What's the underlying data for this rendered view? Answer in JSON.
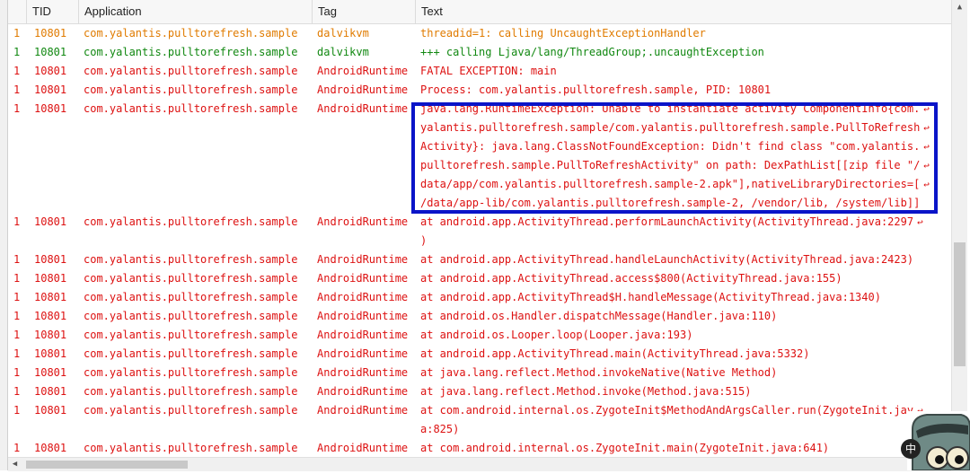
{
  "columns": {
    "tid": "TID",
    "application": "Application",
    "tag": "Tag",
    "text": "Text"
  },
  "colors": {
    "error": "#dd1111",
    "warn": "#e07b00",
    "info": "#118811",
    "highlight": "#0a14c8"
  },
  "rows": [
    {
      "level": "1",
      "tid": "10801",
      "app": "com.yalantis.pulltorefresh.sample",
      "tag": "dalvikvm",
      "text_lines": [
        "threadid=1: calling UncaughtExceptionHandler"
      ],
      "style": "orange"
    },
    {
      "level": "1",
      "tid": "10801",
      "app": "com.yalantis.pulltorefresh.sample",
      "tag": "dalvikvm",
      "text_lines": [
        "+++ calling Ljava/lang/ThreadGroup;.uncaughtException"
      ],
      "style": "green"
    },
    {
      "level": "1",
      "tid": "10801",
      "app": "com.yalantis.pulltorefresh.sample",
      "tag": "AndroidRuntime",
      "text_lines": [
        "FATAL EXCEPTION: main"
      ],
      "style": "red"
    },
    {
      "level": "1",
      "tid": "10801",
      "app": "com.yalantis.pulltorefresh.sample",
      "tag": "AndroidRuntime",
      "text_lines": [
        "Process: com.yalantis.pulltorefresh.sample, PID: 10801"
      ],
      "style": "red"
    },
    {
      "level": "1",
      "tid": "10801",
      "app": "com.yalantis.pulltorefresh.sample",
      "tag": "AndroidRuntime",
      "text_lines": [
        "java.lang.RuntimeException: Unable to instantiate activity ComponentInfo{com.",
        "yalantis.pulltorefresh.sample/com.yalantis.pulltorefresh.sample.PullToRefresh",
        "Activity}: java.lang.ClassNotFoundException: Didn't find class \"com.yalantis.",
        "pulltorefresh.sample.PullToRefreshActivity\" on path: DexPathList[[zip file \"/",
        "data/app/com.yalantis.pulltorefresh.sample-2.apk\"],nativeLibraryDirectories=[",
        "/data/app-lib/com.yalantis.pulltorefresh.sample-2, /vendor/lib, /system/lib]]"
      ],
      "wrap_marks": 5,
      "style": "red",
      "highlight": true
    },
    {
      "level": "1",
      "tid": "10801",
      "app": "com.yalantis.pulltorefresh.sample",
      "tag": "AndroidRuntime",
      "text_lines": [
        "at android.app.ActivityThread.performLaunchActivity(ActivityThread.java:2297",
        ")"
      ],
      "wrap_marks": 1,
      "style": "red"
    },
    {
      "level": "1",
      "tid": "10801",
      "app": "com.yalantis.pulltorefresh.sample",
      "tag": "AndroidRuntime",
      "text_lines": [
        "at android.app.ActivityThread.handleLaunchActivity(ActivityThread.java:2423)"
      ],
      "style": "red"
    },
    {
      "level": "1",
      "tid": "10801",
      "app": "com.yalantis.pulltorefresh.sample",
      "tag": "AndroidRuntime",
      "text_lines": [
        "at android.app.ActivityThread.access$800(ActivityThread.java:155)"
      ],
      "style": "red"
    },
    {
      "level": "1",
      "tid": "10801",
      "app": "com.yalantis.pulltorefresh.sample",
      "tag": "AndroidRuntime",
      "text_lines": [
        "at android.app.ActivityThread$H.handleMessage(ActivityThread.java:1340)"
      ],
      "style": "red"
    },
    {
      "level": "1",
      "tid": "10801",
      "app": "com.yalantis.pulltorefresh.sample",
      "tag": "AndroidRuntime",
      "text_lines": [
        "at android.os.Handler.dispatchMessage(Handler.java:110)"
      ],
      "style": "red"
    },
    {
      "level": "1",
      "tid": "10801",
      "app": "com.yalantis.pulltorefresh.sample",
      "tag": "AndroidRuntime",
      "text_lines": [
        "at android.os.Looper.loop(Looper.java:193)"
      ],
      "style": "red"
    },
    {
      "level": "1",
      "tid": "10801",
      "app": "com.yalantis.pulltorefresh.sample",
      "tag": "AndroidRuntime",
      "text_lines": [
        "at android.app.ActivityThread.main(ActivityThread.java:5332)"
      ],
      "style": "red"
    },
    {
      "level": "1",
      "tid": "10801",
      "app": "com.yalantis.pulltorefresh.sample",
      "tag": "AndroidRuntime",
      "text_lines": [
        "at java.lang.reflect.Method.invokeNative(Native Method)"
      ],
      "style": "red"
    },
    {
      "level": "1",
      "tid": "10801",
      "app": "com.yalantis.pulltorefresh.sample",
      "tag": "AndroidRuntime",
      "text_lines": [
        "at java.lang.reflect.Method.invoke(Method.java:515)"
      ],
      "style": "red"
    },
    {
      "level": "1",
      "tid": "10801",
      "app": "com.yalantis.pulltorefresh.sample",
      "tag": "AndroidRuntime",
      "text_lines": [
        "at com.android.internal.os.ZygoteInit$MethodAndArgsCaller.run(ZygoteInit.jav",
        "a:825)"
      ],
      "wrap_marks": 1,
      "style": "red"
    },
    {
      "level": "1",
      "tid": "10801",
      "app": "com.yalantis.pulltorefresh.sample",
      "tag": "AndroidRuntime",
      "text_lines": [
        "at com.android.internal.os.ZygoteInit.main(ZygoteInit.java:641)"
      ],
      "style": "red"
    }
  ],
  "ime_badge": "中"
}
